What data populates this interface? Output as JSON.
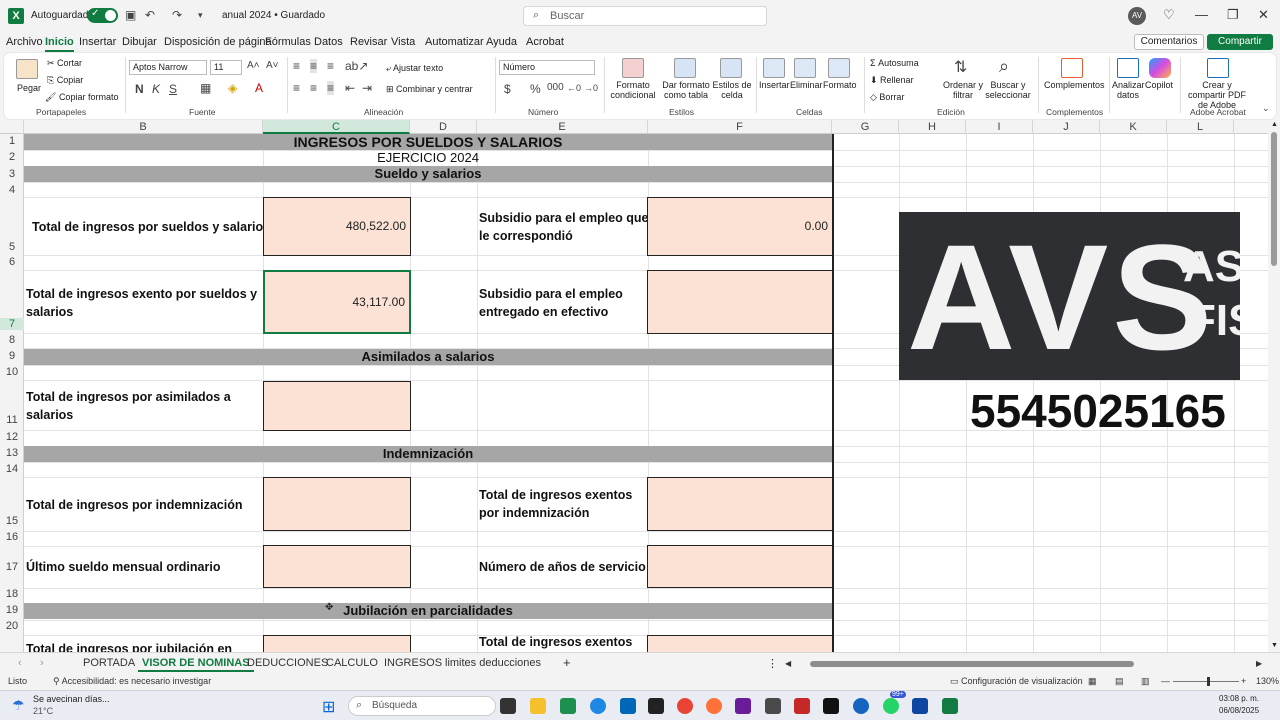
{
  "titlebar": {
    "autosave_label": "Autoguardado",
    "doc_title": "anual 2024 • Guardado",
    "search_placeholder": "Buscar",
    "avatar_initials": "AV"
  },
  "menu": [
    "Archivo",
    "Inicio",
    "Insertar",
    "Dibujar",
    "Disposición de página",
    "Fórmulas",
    "Datos",
    "Revisar",
    "Vista",
    "Automatizar",
    "Ayuda",
    "Acrobat"
  ],
  "menu_active": "Inicio",
  "comments_label": "Comentarios",
  "share_label": "Compartir",
  "ribbon": {
    "paste": "Pegar",
    "cut": "Cortar",
    "copy": "Copiar",
    "format_painter": "Copiar formato",
    "group_clipboard": "Portapapeles",
    "font_name": "Aptos Narrow",
    "font_size": "11",
    "group_font": "Fuente",
    "wrap_text": "Ajustar texto",
    "merge_center": "Combinar y centrar",
    "group_alignment": "Alineación",
    "number_format": "Número",
    "group_number": "Número",
    "cond_format": "Formato condicional",
    "format_table": "Dar formato como tabla",
    "cell_styles": "Estilos de celda",
    "group_styles": "Estilos",
    "insert": "Insertar",
    "delete": "Eliminar",
    "format": "Formato",
    "group_cells": "Celdas",
    "autosum": "Autosuma",
    "fill": "Rellenar",
    "clear": "Borrar",
    "sort_filter": "Ordenar y filtrar",
    "find_select": "Buscar y seleccionar",
    "group_editing": "Edición",
    "addins": "Complementos",
    "group_addins": "Complementos",
    "analyze": "Analizar datos",
    "copilot": "Copilot",
    "create_pdf": "Crear y compartir PDF de Adobe",
    "group_acrobat": "Adobe Acrobat"
  },
  "columns": [
    "B",
    "C",
    "D",
    "E",
    "F",
    "G",
    "H",
    "I",
    "J",
    "K",
    "L"
  ],
  "rows": [
    "1",
    "2",
    "3",
    "4",
    "5",
    "6",
    "7",
    "8",
    "9",
    "10",
    "11",
    "12",
    "13",
    "14",
    "15",
    "16",
    "17",
    "18",
    "19",
    "20"
  ],
  "sheet": {
    "title": "INGRESOS POR SUELDOS Y SALARIOS",
    "subtitle": "EJERCICIO 2024",
    "sec_sueldos": "Sueldo y salarios",
    "total_sueldos_label": "Total de ingresos por sueldos y salarios",
    "total_sueldos_value": "480,522.00",
    "subsidio_label": "Subsidio para el empleo que le correspondió",
    "subsidio_value": "0.00",
    "exento_label": "Total de ingresos exento por sueldos y salarios",
    "exento_value": "43,117.00",
    "subsidio_efectivo_label": "Subsidio para el empleo entregado en efectivo",
    "sec_asimilados": "Asimilados a salarios",
    "asimilados_label": "Total de ingresos por asimilados a salarios",
    "sec_indem": "Indemnización",
    "indem_label": "Total de ingresos por indemnización",
    "indem_exentos_label": "Total de ingresos exentos por indemnización",
    "ultimo_sueldo_label": "Último sueldo mensual ordinario",
    "anios_label": "Número de años de servicio",
    "sec_jubilacion": "Jubilación en parcialidades",
    "jubilacion_label": "Total de ingresos por jubilación en",
    "jubilacion_exentos_label": "Total de ingresos exentos"
  },
  "logo": {
    "big": "AVS",
    "line1": "AS",
    "line2": "FIS",
    "phone": "5545025165"
  },
  "sheet_tabs": [
    "PORTADA",
    "VISOR DE NOMINAS",
    "DEDUCCIONES",
    "CALCULO",
    "INGRESOS",
    "limites deducciones"
  ],
  "active_tab": "VISOR DE NOMINAS",
  "status": {
    "ready": "Listo",
    "accessibility": "Accesibilidad: es necesario investigar",
    "view_settings": "Configuración de visualización",
    "zoom": "130%"
  },
  "taskbar": {
    "weather_text": "Se avecinan días...",
    "temp": "21°C",
    "search": "Búsqueda",
    "time": "03:08 p. m.",
    "date": "06/08/2025",
    "badge": "99+"
  }
}
